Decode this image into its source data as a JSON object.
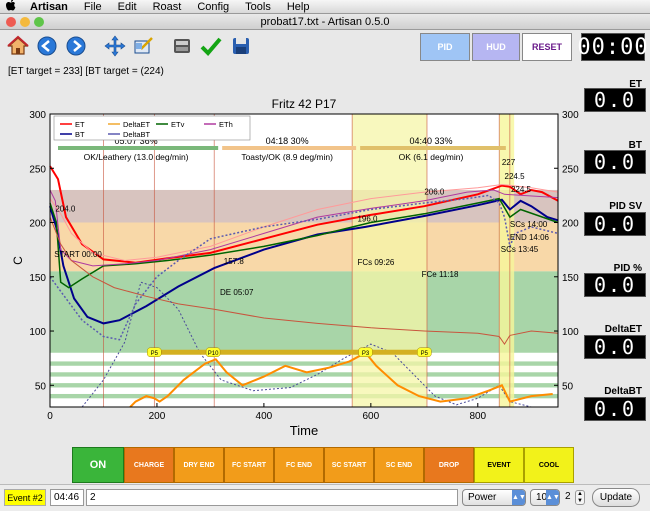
{
  "menubar": {
    "apple": "",
    "app": "Artisan",
    "items": [
      "File",
      "Edit",
      "Roast",
      "Config",
      "Tools",
      "Help"
    ]
  },
  "window": {
    "title": "probat17.txt - Artisan 0.5.0"
  },
  "toolbar": {
    "pid_label": "PID",
    "hud_label": "HUD",
    "reset_label": "RESET",
    "timer": "00:00"
  },
  "targets": "[ET target = 233]  [BT target =   (224)",
  "readouts": [
    {
      "label": "ET",
      "value": "0.0"
    },
    {
      "label": "BT",
      "value": "0.0"
    },
    {
      "label": "PID SV",
      "value": "0.0"
    },
    {
      "label": "PID %",
      "value": "0.0"
    },
    {
      "label": "DeltaET",
      "value": "0.0"
    },
    {
      "label": "DeltaBT",
      "value": "0.0"
    }
  ],
  "chart_data": {
    "type": "line",
    "title": "Fritz 42 P17",
    "xlabel": "Time",
    "ylabel": "C",
    "xlim": [
      0,
      950
    ],
    "ylim": [
      30,
      300
    ],
    "xticks": [
      0,
      200,
      400,
      600,
      800
    ],
    "yticks": [
      50,
      100,
      150,
      200,
      250,
      300
    ],
    "legend": [
      "ET",
      "DeltaET",
      "ETv",
      "ETh",
      "BT",
      "DeltaBT"
    ],
    "phases": [
      {
        "label": "05:07 36%",
        "desc": "OK/Leathery (13.0 deg/min)",
        "x0": 0,
        "x1": 307,
        "color": "#7ab87a"
      },
      {
        "label": "04:18 30%",
        "desc": "Toasty/OK (8.9 deg/min)",
        "x0": 307,
        "x1": 565,
        "color": "#f2c48a"
      },
      {
        "label": "04:40 33%",
        "desc": "OK (6.1 deg/min)",
        "x0": 565,
        "x1": 845,
        "color": "#e0c06a"
      }
    ],
    "bands": [
      {
        "y0": 200,
        "y1": 230,
        "color": "#d8c4bf"
      },
      {
        "y0": 155,
        "y1": 200,
        "color": "#f8d8a8"
      },
      {
        "y0": 80,
        "y1": 155,
        "color": "#a8d5a8"
      }
    ],
    "annotations": [
      {
        "text": "204.0",
        "x": 10,
        "y": 210
      },
      {
        "text": "START 00:00",
        "x": 8,
        "y": 168
      },
      {
        "text": "157.8",
        "x": 325,
        "y": 162
      },
      {
        "text": "DE 05:07",
        "x": 318,
        "y": 133
      },
      {
        "text": "196.0",
        "x": 575,
        "y": 201
      },
      {
        "text": "FCs 09:26",
        "x": 575,
        "y": 161
      },
      {
        "text": "206.0",
        "x": 700,
        "y": 226
      },
      {
        "text": "FCe 11:18",
        "x": 695,
        "y": 150
      },
      {
        "text": "224.5",
        "x": 850,
        "y": 240
      },
      {
        "text": "224.5",
        "x": 862,
        "y": 228
      },
      {
        "text": "SCs 14:00",
        "x": 860,
        "y": 196
      },
      {
        "text": "END 14:06",
        "x": 860,
        "y": 184
      },
      {
        "text": "SCs 13:45",
        "x": 843,
        "y": 173
      },
      {
        "text": "227",
        "x": 845,
        "y": 253
      }
    ],
    "events": [
      {
        "label": "P5",
        "x": 195
      },
      {
        "label": "P10",
        "x": 305
      },
      {
        "label": "P3",
        "x": 590
      },
      {
        "label": "P5",
        "x": 700
      }
    ],
    "series": [
      {
        "name": "ET",
        "color": "#ff0000",
        "width": 2,
        "values": [
          [
            0,
            252
          ],
          [
            15,
            240
          ],
          [
            30,
            205
          ],
          [
            60,
            180
          ],
          [
            100,
            166
          ],
          [
            160,
            163
          ],
          [
            220,
            167
          ],
          [
            300,
            172
          ],
          [
            400,
            185
          ],
          [
            500,
            198
          ],
          [
            600,
            207
          ],
          [
            700,
            215
          ],
          [
            800,
            226
          ],
          [
            845,
            234
          ],
          [
            860,
            233
          ],
          [
            880,
            226
          ],
          [
            900,
            230
          ],
          [
            920,
            228
          ],
          [
            950,
            220
          ]
        ]
      },
      {
        "name": "BT",
        "color": "#00008b",
        "width": 2,
        "values": [
          [
            0,
            215
          ],
          [
            12,
            195
          ],
          [
            25,
            160
          ],
          [
            45,
            130
          ],
          [
            70,
            113
          ],
          [
            100,
            107
          ],
          [
            130,
            110
          ],
          [
            180,
            123
          ],
          [
            240,
            141
          ],
          [
            307,
            158
          ],
          [
            400,
            175
          ],
          [
            500,
            189
          ],
          [
            590,
            196
          ],
          [
            700,
            206
          ],
          [
            800,
            216
          ],
          [
            845,
            221
          ],
          [
            860,
            212
          ],
          [
            880,
            220
          ],
          [
            900,
            215
          ],
          [
            930,
            205
          ],
          [
            950,
            202
          ]
        ]
      },
      {
        "name": "ETv",
        "color": "#006400",
        "width": 1.5,
        "values": [
          [
            0,
            218
          ],
          [
            12,
            200
          ],
          [
            20,
            145
          ],
          [
            35,
            140
          ],
          [
            60,
            148
          ],
          [
            100,
            160
          ],
          [
            160,
            162
          ],
          [
            220,
            165
          ],
          [
            300,
            170
          ],
          [
            400,
            178
          ],
          [
            500,
            188
          ],
          [
            600,
            200
          ],
          [
            700,
            208
          ],
          [
            800,
            218
          ],
          [
            840,
            222
          ],
          [
            860,
            205
          ],
          [
            880,
            212
          ],
          [
            950,
            200
          ]
        ]
      },
      {
        "name": "ETh",
        "color": "#b03aa0",
        "width": 1,
        "values": [
          [
            0,
            230
          ],
          [
            10,
            220
          ],
          [
            20,
            175
          ],
          [
            40,
            165
          ],
          [
            80,
            160
          ],
          [
            140,
            162
          ],
          [
            200,
            165
          ],
          [
            300,
            175
          ],
          [
            400,
            190
          ],
          [
            500,
            205
          ],
          [
            600,
            213
          ],
          [
            700,
            220
          ],
          [
            780,
            228
          ],
          [
            830,
            230
          ],
          [
            850,
            226
          ],
          [
            950,
            223
          ]
        ]
      },
      {
        "name": "ETpale",
        "color": "#ff9a9a",
        "width": 1,
        "values": [
          [
            0,
            222
          ],
          [
            20,
            208
          ],
          [
            40,
            190
          ],
          [
            80,
            172
          ],
          [
            140,
            165
          ],
          [
            200,
            168
          ],
          [
            300,
            178
          ],
          [
            400,
            196
          ],
          [
            500,
            212
          ],
          [
            600,
            222
          ],
          [
            700,
            228
          ],
          [
            800,
            232
          ],
          [
            845,
            235
          ],
          [
            900,
            232
          ],
          [
            950,
            228
          ]
        ]
      },
      {
        "name": "DeltaET",
        "color": "#c8553d",
        "width": 1,
        "values": [
          [
            0,
            205
          ],
          [
            20,
            180
          ],
          [
            40,
            165
          ],
          [
            80,
            150
          ],
          [
            120,
            140
          ],
          [
            180,
            132
          ],
          [
            240,
            125
          ],
          [
            307,
            120
          ],
          [
            400,
            112
          ],
          [
            500,
            107
          ],
          [
            600,
            103
          ],
          [
            700,
            100
          ],
          [
            800,
            98
          ],
          [
            840,
            95
          ],
          [
            850,
            88
          ],
          [
            860,
            96
          ],
          [
            900,
            100
          ],
          [
            950,
            98
          ]
        ]
      },
      {
        "name": "DeltaBT",
        "color": "#5a5ab0",
        "width": 1.5,
        "dash": "2,2",
        "values": [
          [
            0,
            150
          ],
          [
            30,
            130
          ],
          [
            60,
            110
          ],
          [
            100,
            95
          ],
          [
            130,
            92
          ],
          [
            160,
            125
          ],
          [
            200,
            150
          ],
          [
            240,
            165
          ],
          [
            300,
            185
          ],
          [
            400,
            196
          ],
          [
            500,
            203
          ],
          [
            600,
            212
          ],
          [
            700,
            218
          ],
          [
            780,
            222
          ],
          [
            820,
            225
          ],
          [
            840,
            218
          ],
          [
            850,
            205
          ],
          [
            860,
            178
          ],
          [
            870,
            190
          ],
          [
            900,
            196
          ],
          [
            950,
            190
          ]
        ]
      },
      {
        "name": "DeltaBT2",
        "color": "#4a4a9a",
        "width": 1,
        "dash": "2,2",
        "values": [
          [
            60,
            30
          ],
          [
            100,
            55
          ],
          [
            140,
            90
          ],
          [
            170,
            145
          ],
          [
            200,
            140
          ],
          [
            240,
            120
          ],
          [
            280,
            80
          ],
          [
            320,
            55
          ],
          [
            380,
            45
          ],
          [
            450,
            48
          ],
          [
            500,
            60
          ],
          [
            550,
            75
          ],
          [
            600,
            88
          ],
          [
            640,
            80
          ],
          [
            680,
            60
          ],
          [
            720,
            40
          ],
          [
            760,
            32
          ],
          [
            800,
            38
          ],
          [
            840,
            50
          ],
          [
            860,
            35
          ],
          [
            900,
            30
          ]
        ]
      },
      {
        "name": "Heater",
        "color": "#ff8c00",
        "width": 2,
        "values": [
          [
            150,
            30
          ],
          [
            160,
            35
          ],
          [
            180,
            40
          ],
          [
            195,
            38
          ],
          [
            205,
            35
          ],
          [
            220,
            40
          ],
          [
            250,
            55
          ],
          [
            290,
            70
          ],
          [
            310,
            74
          ],
          [
            330,
            62
          ],
          [
            360,
            50
          ],
          [
            400,
            58
          ],
          [
            440,
            68
          ],
          [
            480,
            62
          ],
          [
            520,
            66
          ],
          [
            560,
            72
          ],
          [
            590,
            80
          ],
          [
            610,
            68
          ],
          [
            650,
            50
          ],
          [
            690,
            40
          ],
          [
            730,
            35
          ],
          [
            780,
            38
          ],
          [
            820,
            45
          ],
          [
            845,
            50
          ],
          [
            860,
            35
          ],
          [
            900,
            40
          ],
          [
            940,
            42
          ]
        ]
      }
    ]
  },
  "event_buttons": [
    {
      "label": "ON",
      "color": "#3ab53a",
      "text": "#ffffff"
    },
    {
      "label": "CHARGE",
      "color": "#e8781e",
      "text": "#ffffff"
    },
    {
      "label": "DRY END",
      "color": "#f29c1a",
      "text": "#ffffff"
    },
    {
      "label": "FC START",
      "color": "#f29c1a",
      "text": "#ffffff"
    },
    {
      "label": "FC END",
      "color": "#f29c1a",
      "text": "#ffffff"
    },
    {
      "label": "SC START",
      "color": "#f29c1a",
      "text": "#ffffff"
    },
    {
      "label": "SC END",
      "color": "#f29c1a",
      "text": "#ffffff"
    },
    {
      "label": "DROP",
      "color": "#e8781e",
      "text": "#ffffff"
    },
    {
      "label": "EVENT",
      "color": "#f2f21a",
      "text": "#000000"
    },
    {
      "label": "COOL",
      "color": "#f2f21a",
      "text": "#000000"
    }
  ],
  "bottom": {
    "event_label": "Event #2",
    "time": "04:46",
    "value": "2",
    "type_select": "Power",
    "num_select": "10",
    "small_value": "2",
    "update_label": "Update"
  }
}
